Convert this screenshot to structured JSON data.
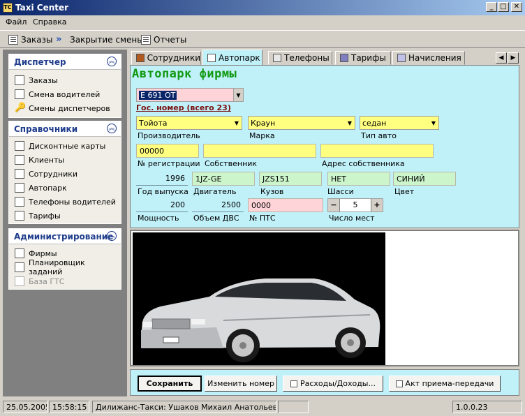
{
  "window": {
    "title": "Taxi Center",
    "app_icon": "TC",
    "minimize": "_",
    "maximize": "□",
    "close": "✕"
  },
  "menu": [
    "Файл",
    "Справка"
  ],
  "toolbar": {
    "orders": "Заказы",
    "close_shift": "Закрытие смены",
    "reports": "Отчеты"
  },
  "sidebar": {
    "dispatcher": {
      "title": "Диспетчер",
      "items": [
        "Заказы",
        "Смена водителей",
        "Смены диспетчеров"
      ]
    },
    "references": {
      "title": "Справочники",
      "items": [
        "Дисконтные карты",
        "Клиенты",
        "Сотрудники",
        "Автопарк",
        "Телефоны водителей",
        "Тарифы"
      ]
    },
    "admin": {
      "title": "Администрирование",
      "items": [
        "Фирмы",
        "Планировщик заданий",
        "База ГТС"
      ]
    }
  },
  "tabs": [
    "Сотрудники",
    "Автопарк",
    "Телефоны",
    "Тарифы",
    "Начисления"
  ],
  "active_tab": "Автопарк",
  "form": {
    "heading": "Автопарк фирмы",
    "plate": {
      "value": "Е 691 ОТ",
      "label": "Гос. номер (всего 23)"
    },
    "manufacturer": {
      "value": "Тойота",
      "label": "Производитель"
    },
    "brand": {
      "value": "Краун",
      "label": "Марка"
    },
    "car_type": {
      "value": "седан",
      "label": "Тип авто"
    },
    "reg_number": {
      "value": "00000",
      "label": "№ регистрации"
    },
    "owner": {
      "value": "",
      "label": "Собственник"
    },
    "owner_address": {
      "value": "",
      "label": "Адрес собственника"
    },
    "year": {
      "value": "1996",
      "label": "Год выпуска"
    },
    "engine": {
      "value": "1JZ-GE",
      "label": "Двигатель"
    },
    "body": {
      "value": "JZS151",
      "label": "Кузов"
    },
    "chassis": {
      "value": "НЕТ",
      "label": "Шасси"
    },
    "color": {
      "value": "СИНИЙ",
      "label": "Цвет"
    },
    "power": {
      "value": "200",
      "label": "Мощность"
    },
    "displacement": {
      "value": "2500",
      "label": "Объем ДВС"
    },
    "pts": {
      "value": "0000",
      "label": "№ ПТС"
    },
    "seats": {
      "value": "5",
      "label": "Число мест",
      "minus": "−",
      "plus": "+"
    }
  },
  "buttons": {
    "save": "Сохранить",
    "change_number": "Изменить номер",
    "expenses": "Расходы/Доходы...",
    "act": "Акт приема-передачи"
  },
  "status": {
    "date": "25.05.2005",
    "time": "15:58:15",
    "user": "Дилижанс-Такси: Ушаков Михаил Анатольевич",
    "version": "1.0.0.23"
  },
  "colors": {
    "heading": "#129a12",
    "form_bg": "#c0f0f8",
    "required_field": "#ffff80",
    "key_field": "#ffd4d8",
    "info_field": "#ccf5cc",
    "plate_label": "#7a1010"
  }
}
